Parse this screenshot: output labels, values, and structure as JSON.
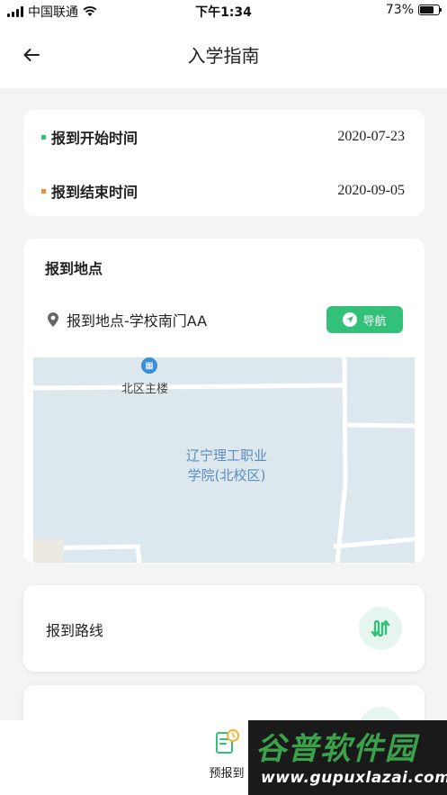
{
  "status_bar": {
    "carrier": "中国联通",
    "time": "下午1:34",
    "battery_text": "73%",
    "battery_level": 0.73
  },
  "nav": {
    "title": "入学指南",
    "back_icon": "back-arrow-icon"
  },
  "dates": {
    "start_label": "报到开始时间",
    "start_value": "2020-07-23",
    "start_color": "#33c17a",
    "end_label": "报到结束时间",
    "end_value": "2020-09-05",
    "end_color": "#f08a3c"
  },
  "location": {
    "title": "报到地点",
    "address": "报到地点-学校南门AA",
    "navigate_label": "导航",
    "map": {
      "building_label": "北区主楼",
      "campus_label_line1": "辽宁理工职业",
      "campus_label_line2": "学院(北校区)"
    }
  },
  "route": {
    "label": "报到路线",
    "icon": "route-icon"
  },
  "tabbar": {
    "item_label": "预报到"
  },
  "watermark": {
    "main": "谷普软件园",
    "url": "www.gupuxlazai.com"
  },
  "colors": {
    "accent": "#33c17a",
    "background": "#f4f4f4"
  }
}
